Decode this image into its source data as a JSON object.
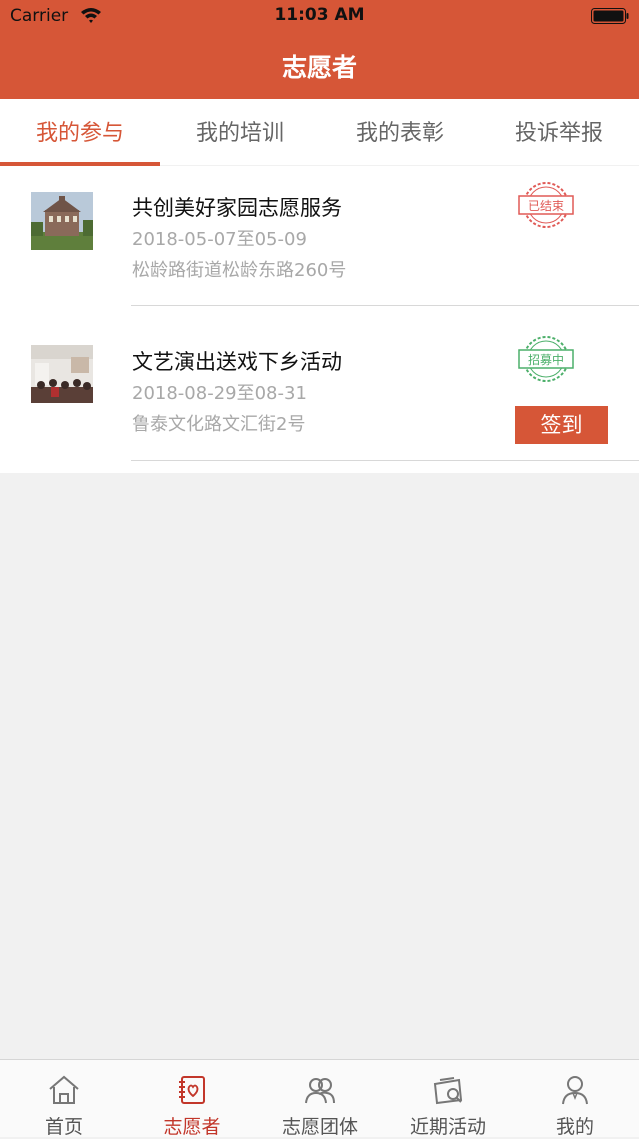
{
  "status_bar": {
    "carrier": "Carrier",
    "time": "11:03 AM"
  },
  "nav": {
    "title": "志愿者"
  },
  "tabs": [
    {
      "label": "我的参与",
      "active": true
    },
    {
      "label": "我的培训",
      "active": false
    },
    {
      "label": "我的表彰",
      "active": false
    },
    {
      "label": "投诉举报",
      "active": false
    }
  ],
  "activities": [
    {
      "title": "共创美好家园志愿服务",
      "date": "2018-05-07至05-09",
      "address": "松龄路街道松龄东路260号",
      "stamp": "已结束",
      "stamp_color": "#e05a56"
    },
    {
      "title": "文艺演出送戏下乡活动",
      "date": "2018-08-29至08-31",
      "address": "鲁泰文化路文汇街2号",
      "stamp": "招募中",
      "stamp_color": "#4caf6a",
      "action": "签到"
    }
  ],
  "bottom_tabs": [
    {
      "label": "首页",
      "icon": "home-icon",
      "active": false
    },
    {
      "label": "志愿者",
      "icon": "volunteer-book-icon",
      "active": true
    },
    {
      "label": "志愿团体",
      "icon": "group-icon",
      "active": false
    },
    {
      "label": "近期活动",
      "icon": "activity-icon",
      "active": false
    },
    {
      "label": "我的",
      "icon": "user-icon",
      "active": false
    }
  ],
  "colors": {
    "brand": "#d65637",
    "active_tab_text": "#c2362a"
  }
}
